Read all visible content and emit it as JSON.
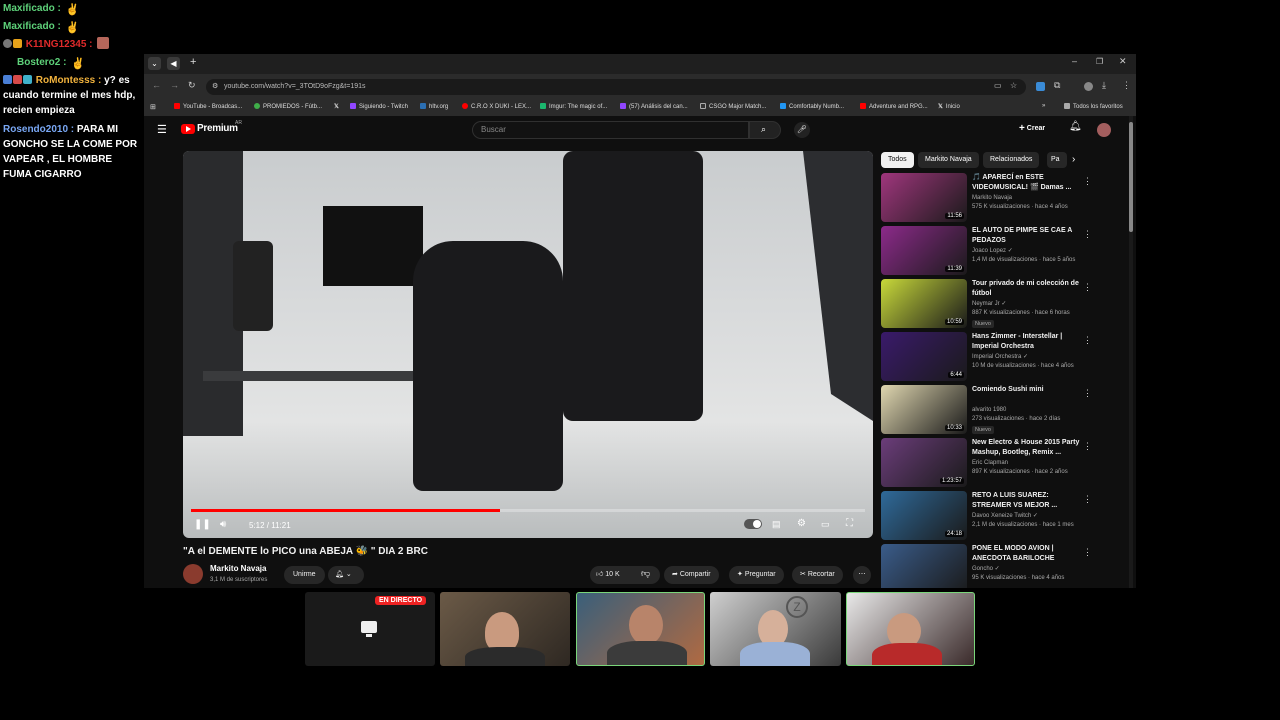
{
  "chat": [
    {
      "nick": "Maxificado :",
      "color": "#5ed27a",
      "message": ""
    },
    {
      "nick": "Maxificado :",
      "color": "#5ed27a",
      "message": ""
    },
    {
      "nick": "K11NG12345 :",
      "color": "#e02b2b",
      "message": ""
    },
    {
      "nick": "Bostero2 :",
      "color": "#5ed27a",
      "message": ""
    },
    {
      "nick": "RoMontesss :",
      "color": "#f2b33d",
      "message": "y? es cuando termine el mes hdp, recien empieza"
    },
    {
      "nick": "Rosendo2010 :",
      "color": "#7aa8f5",
      "message": "PARA MI GONCHO SE LA COME POR VAPEAR , EL HOMBRE FUMA CIGARRO"
    }
  ],
  "browser": {
    "url": "youtube.com/watch?v=_3TOtD9oFzg&t=191s",
    "bookmarks": [
      "YouTube - Broadcas...",
      "PROMIEDOS - Fútb...",
      "Siguiendo - Twitch",
      "hltv.org",
      "C.R.O X DUKI - LEX...",
      "Imgur: The magic of...",
      "(57) Análisis del can...",
      "CSGO Major Match...",
      "Comfortably Numb...",
      "Adventure and RPG...",
      "Inicio"
    ],
    "all_bookmarks": "Todos los favoritos"
  },
  "youtube": {
    "logo": "Premium",
    "logo_sup": "AR",
    "search_placeholder": "Buscar",
    "create_label": "Crear",
    "video": {
      "time": "5:12 / 11:21",
      "progress": 0.459,
      "title": "\"A el DEMENTE lo PICO una ABEJA 🐝 \" DIA 2 BRC",
      "channel": "Markito Navaja",
      "subscribers": "3,1 M de suscriptores",
      "join_label": "Unirme",
      "likes": "10 K",
      "share_label": "Compartir",
      "ask_label": "Preguntar",
      "clip_label": "Recortar"
    },
    "chips": [
      "Todos",
      "Markito Navaja",
      "Relacionados",
      "Pa"
    ],
    "recommendations": [
      {
        "title": "🎵 APARECÍ en ESTE VIDEOMUSICAL! 🎬 Damas ...",
        "channel": "Markito Navaja",
        "meta": "575 K visualizaciones · hace 4 años",
        "duration": "11:56",
        "badge": "",
        "thumb": "#a0367d"
      },
      {
        "title": "EL AUTO DE PIMPE SE CAE A PEDAZOS",
        "channel": "Joaco Lopez ✓",
        "meta": "1,4 M de visualizaciones · hace 5 años",
        "duration": "11:39",
        "badge": "",
        "thumb": "#8c2a8a"
      },
      {
        "title": "Tour privado de mi colección de fútbol",
        "channel": "Neymar Jr ✓",
        "meta": "887 K visualizaciones · hace 6 horas",
        "duration": "10:59",
        "badge": "Nuevo",
        "thumb": "#c8d93a"
      },
      {
        "title": "Hans Zimmer - Interstellar | Imperial Orchestra",
        "channel": "Imperial Orchestra ✓",
        "meta": "10 M de visualizaciones · hace 4 años",
        "duration": "6:44",
        "badge": "",
        "thumb": "#3a1a6b"
      },
      {
        "title": "Comiendo Sushi mini",
        "channel": "alvarito 1980",
        "meta": "273 visualizaciones · hace 2 días",
        "duration": "10:33",
        "badge": "Nuevo",
        "thumb": "#e0d7b0"
      },
      {
        "title": "New Electro & House 2015 Party Mashup, Bootleg, Remix ...",
        "channel": "Eric Clapman",
        "meta": "897 K visualizaciones · hace 2 años",
        "duration": "1:23:57",
        "badge": "",
        "thumb": "#6b3d7a"
      },
      {
        "title": "RETO A LUIS SUAREZ: STREAMER VS MEJOR ...",
        "channel": "Davoo Xeneize Twitch ✓",
        "meta": "2,1 M de visualizaciones · hace 1 mes",
        "duration": "24:18",
        "badge": "",
        "thumb": "#2f6a9a"
      },
      {
        "title": "PONE EL MODO AVION | ANECDOTA BARILOCHE",
        "channel": "Goncho ✓",
        "meta": "95 K visualizaciones · hace 4 años",
        "duration": "",
        "badge": "",
        "thumb": "#3a5c8a"
      }
    ]
  },
  "live_badge": "EN DIRECTO"
}
